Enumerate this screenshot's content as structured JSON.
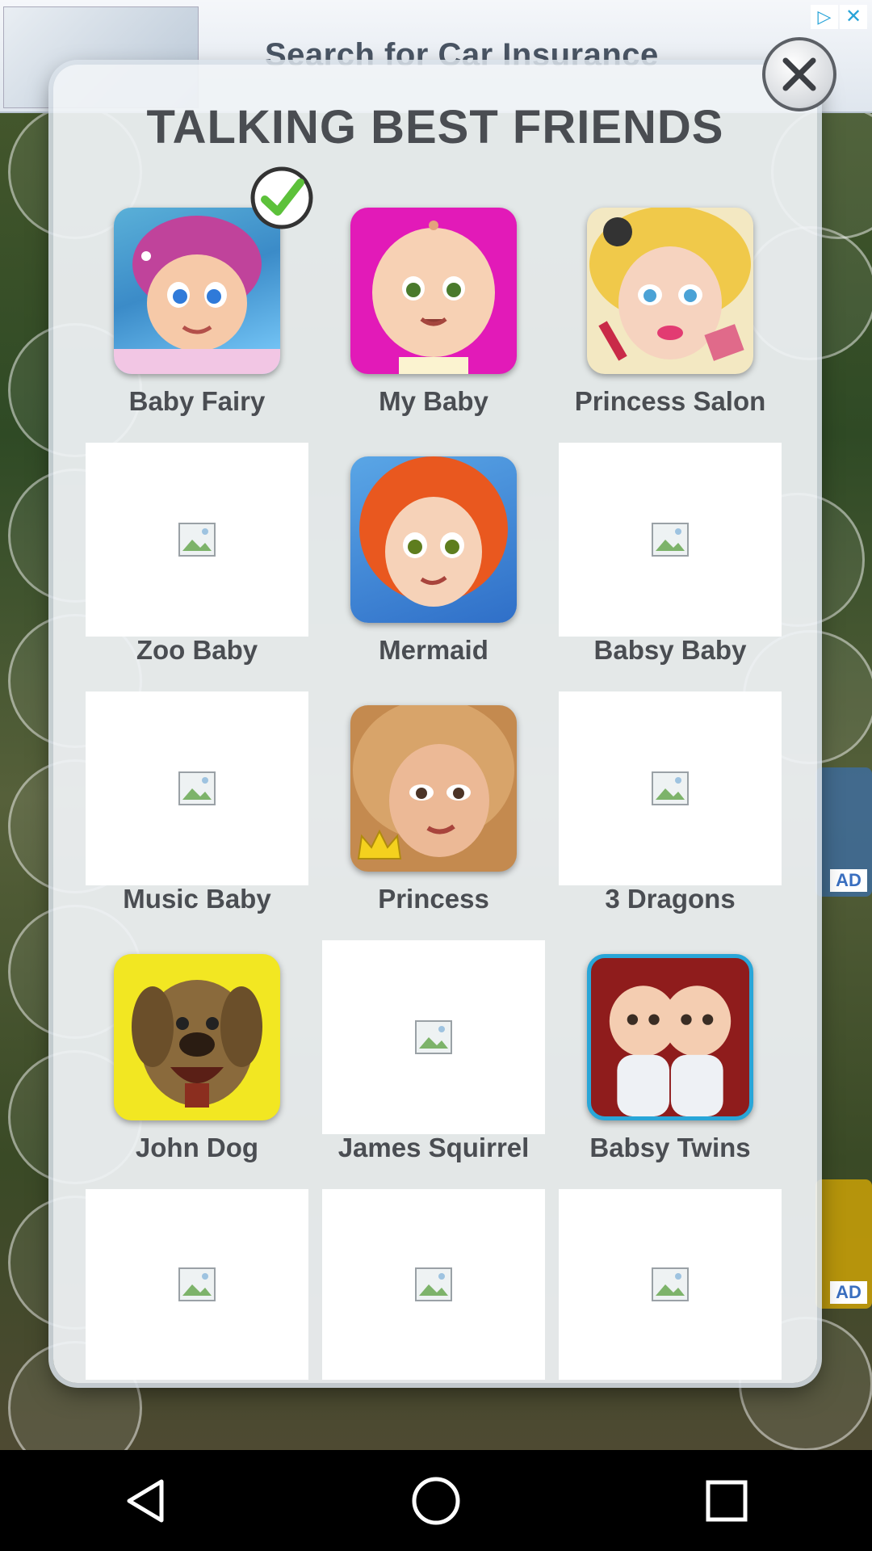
{
  "ad": {
    "text": "Search for Car Insurance",
    "choices_icon": "ad-choices-icon",
    "close_icon": "close-icon"
  },
  "background": {
    "ad_badges": [
      "AD",
      "AD"
    ]
  },
  "dialog": {
    "title": "TALKING BEST FRIENDS",
    "close_icon": "close-icon",
    "apps": [
      {
        "label": "Baby Fairy",
        "installed": true,
        "image": "icon"
      },
      {
        "label": "My Baby",
        "image": "icon"
      },
      {
        "label": "Princess Salon",
        "image": "icon"
      },
      {
        "label": "Zoo Baby",
        "image": "broken"
      },
      {
        "label": "Mermaid",
        "image": "icon"
      },
      {
        "label": "Babsy Baby",
        "image": "broken"
      },
      {
        "label": "Music Baby",
        "image": "broken"
      },
      {
        "label": "Princess",
        "image": "icon"
      },
      {
        "label": "3 Dragons",
        "image": "broken"
      },
      {
        "label": "John Dog",
        "image": "icon"
      },
      {
        "label": "James Squirrel",
        "image": "broken"
      },
      {
        "label": "Babsy Twins",
        "image": "icon"
      }
    ],
    "extra_tiles": 3
  },
  "navbar": {
    "back": "back-icon",
    "home": "home-icon",
    "recents": "recents-icon"
  },
  "colors": {
    "title": "#4a4d52",
    "my_baby_bg": "#e21ab8",
    "check_green": "#5cc13a"
  }
}
